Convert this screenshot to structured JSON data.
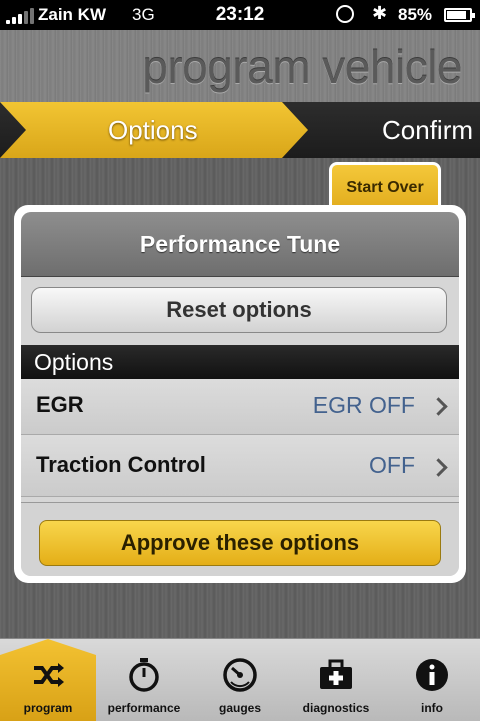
{
  "status_bar": {
    "carrier": "Zain KW",
    "network": "3G",
    "time": "23:12",
    "battery_percent": "85%",
    "battery_level": 0.85
  },
  "header": {
    "title": "program vehicle"
  },
  "steps": {
    "active": "Options",
    "next": "Confirm"
  },
  "start_over_label": "Start Over",
  "panel": {
    "title": "Performance Tune",
    "reset_label": "Reset options",
    "section_label": "Options",
    "rows": [
      {
        "label": "EGR",
        "value": "EGR OFF"
      },
      {
        "label": "Traction Control",
        "value": "OFF"
      }
    ],
    "approve_label": "Approve these options"
  },
  "tabs": [
    {
      "label": "program",
      "icon": "shuffle-icon"
    },
    {
      "label": "performance",
      "icon": "stopwatch-icon"
    },
    {
      "label": "gauges",
      "icon": "gauge-icon"
    },
    {
      "label": "diagnostics",
      "icon": "medkit-icon"
    },
    {
      "label": "info",
      "icon": "info-icon"
    }
  ],
  "colors": {
    "accent": "#f0bf2e",
    "value_text": "#43628e"
  }
}
